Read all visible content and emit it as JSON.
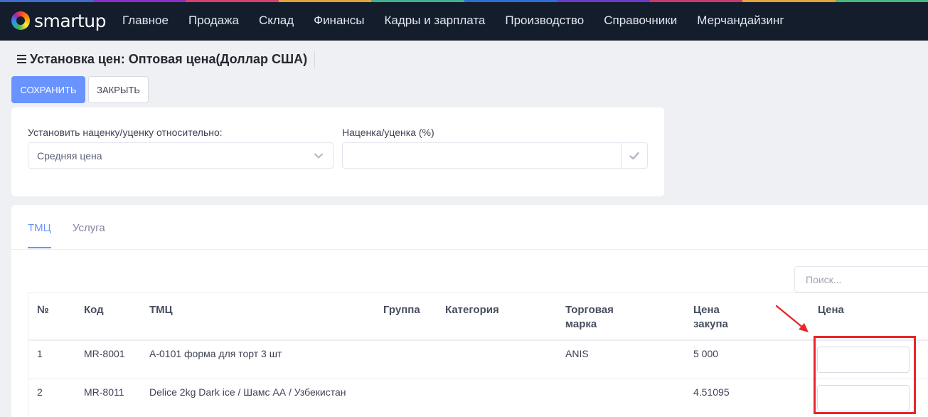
{
  "brand": {
    "name": "smartup"
  },
  "stripe_colors": [
    "#3f6bc9",
    "#8b2fc9",
    "#d6406e",
    "#e0a33a",
    "#3fb08f",
    "#2c6fd1",
    "#6f3ac9",
    "#c93a6b",
    "#e3a43b",
    "#48b77c"
  ],
  "nav": {
    "items": [
      "Главное",
      "Продажа",
      "Склад",
      "Финансы",
      "Кадры и зарплата",
      "Производство",
      "Справочники",
      "Мерчандайзинг"
    ]
  },
  "header": {
    "title": "Установка цен: Оптовая цена(Доллар США)"
  },
  "actions": {
    "save_label": "СОХРАНИТЬ",
    "close_label": "ЗАКРЫТЬ"
  },
  "settings": {
    "relative_label": "Установить наценку/уценку относительно:",
    "relative_value": "Средняя цена",
    "markup_label": "Наценка/уценка (%)",
    "markup_value": ""
  },
  "tabs": [
    {
      "label": "ТМЦ",
      "active": true
    },
    {
      "label": "Услуга",
      "active": false
    }
  ],
  "search": {
    "placeholder": "Поиск..."
  },
  "table": {
    "columns": {
      "num": "№",
      "code": "Код",
      "tmc": "ТМЦ",
      "group": "Группа",
      "category": "Категория",
      "brand_line1": "Торговая",
      "brand_line2": "марка",
      "cost_line1": "Цена",
      "cost_line2": "закупа",
      "price": "Цена"
    },
    "rows": [
      {
        "num": "1",
        "code": "MR-8001",
        "tmc": "А-0101 форма для торт 3 шт",
        "group": "",
        "category": "",
        "brand": "ANIS",
        "cost": "5 000",
        "price": ""
      },
      {
        "num": "2",
        "code": "MR-8011",
        "tmc": "Delice 2kg Dark ice / Шамс АА / Узбекистан",
        "group": "",
        "category": "",
        "brand": "",
        "cost": "4.51095",
        "price": ""
      }
    ]
  },
  "colors": {
    "topbar": "#141d2c",
    "primary": "#6993ff",
    "annotation": "#e8262b"
  }
}
